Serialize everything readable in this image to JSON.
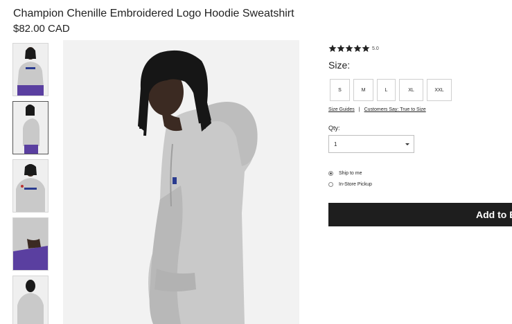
{
  "product": {
    "title": "Champion Chenille Embroidered Logo Hoodie Sweatshirt",
    "price": "$82.00 CAD"
  },
  "gallery": {
    "thumbnails": [
      {
        "label": "front view"
      },
      {
        "label": "side view"
      },
      {
        "label": "front chest logo"
      },
      {
        "label": "sleeve detail"
      },
      {
        "label": "back view"
      }
    ],
    "selected_index": 1
  },
  "rating": {
    "stars": 5,
    "value": "5.0"
  },
  "size": {
    "label": "Size:",
    "options": [
      "S",
      "M",
      "L",
      "XL",
      "XXL"
    ]
  },
  "links": {
    "size_guides": "Size Guides",
    "separator": "|",
    "customers_say": "Customers Say: True to Size"
  },
  "quantity": {
    "label": "Qty:",
    "value": "1"
  },
  "shipping": {
    "options": [
      {
        "label": "Ship to me",
        "checked": true
      },
      {
        "label": "In-Store Pickup",
        "checked": false
      }
    ]
  },
  "cart": {
    "add_label": "Add to Bag"
  },
  "colors": {
    "button_bg": "#1e1e1e",
    "hoodie_grey": "#c9c9c9",
    "backdrop": "#f2f2f2"
  }
}
